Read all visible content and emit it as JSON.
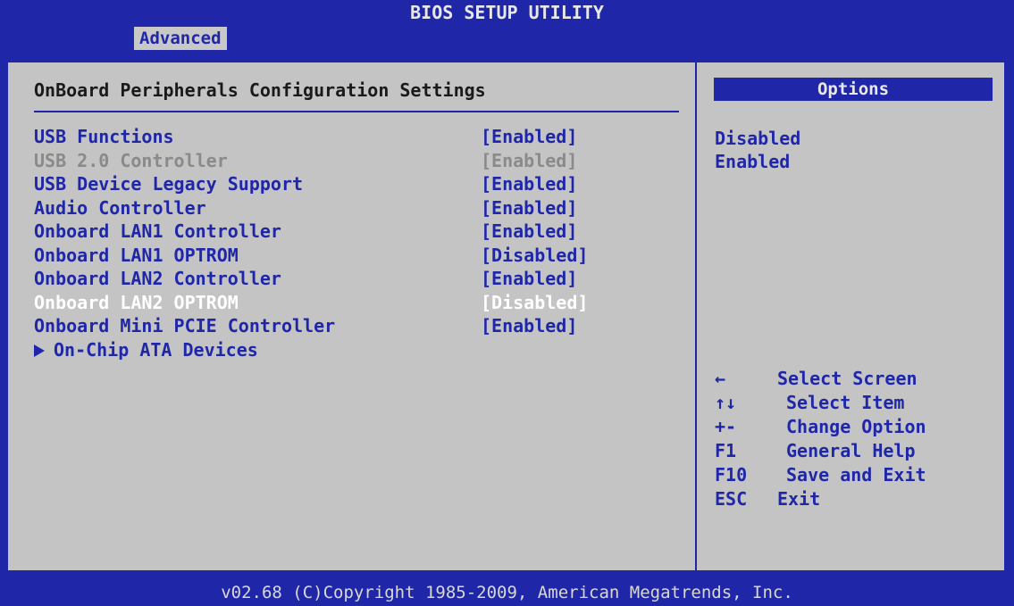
{
  "title": "BIOS SETUP UTILITY",
  "tabs": [
    {
      "label": "Advanced",
      "active": true
    }
  ],
  "section_title": "OnBoard Peripherals Configuration Settings",
  "settings": [
    {
      "label": "USB Functions",
      "value": "[Enabled]",
      "state": "normal"
    },
    {
      "label": "USB 2.0 Controller",
      "value": "[Enabled]",
      "state": "disabled"
    },
    {
      "label": "USB Device Legacy Support",
      "value": "[Enabled]",
      "state": "normal"
    },
    {
      "label": "Audio Controller",
      "value": "[Enabled]",
      "state": "normal"
    },
    {
      "label": "Onboard LAN1 Controller",
      "value": "[Enabled]",
      "state": "normal"
    },
    {
      "label": "Onboard LAN1 OPTROM",
      "value": "[Disabled]",
      "state": "normal"
    },
    {
      "label": "Onboard LAN2 Controller",
      "value": "[Enabled]",
      "state": "normal"
    },
    {
      "label": "Onboard LAN2 OPTROM",
      "value": "[Disabled]",
      "state": "selected"
    },
    {
      "label": "Onboard Mini PCIE Controller",
      "value": "[Enabled]",
      "state": "normal"
    },
    {
      "label": "On-Chip ATA Devices",
      "value": "",
      "state": "submenu"
    }
  ],
  "options": {
    "header": "Options",
    "items": [
      "Disabled",
      "Enabled"
    ]
  },
  "help": [
    {
      "key": "←",
      "desc": "Select Screen"
    },
    {
      "key": "↑↓",
      "desc": "Select Item"
    },
    {
      "key": "+-",
      "desc": "Change Option"
    },
    {
      "key": "F1",
      "desc": "General Help"
    },
    {
      "key": "F10",
      "desc": "Save and Exit"
    },
    {
      "key": "ESC",
      "desc": "Exit"
    }
  ],
  "footer": "v02.68 (C)Copyright 1985-2009, American Megatrends, Inc.",
  "colors": {
    "background_blue": "#1f27a8",
    "panel_gray": "#c4c4c4",
    "text_blue": "#1f27a8",
    "selected_text": "#ffffff",
    "disabled_text": "#8a8a8a"
  }
}
